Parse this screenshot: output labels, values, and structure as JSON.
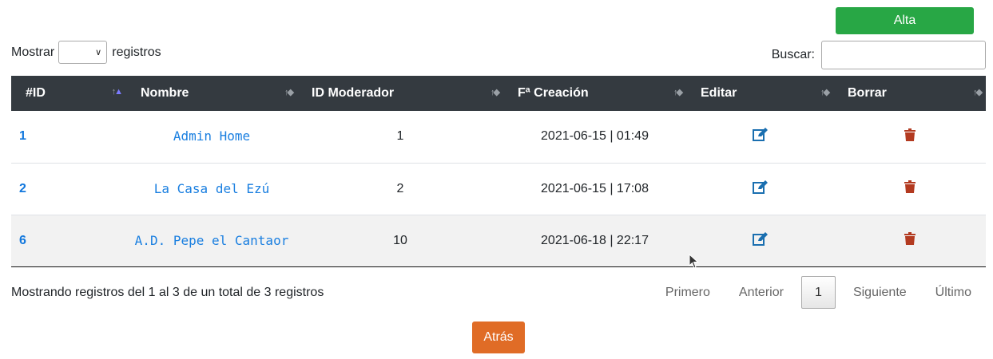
{
  "toolbar": {
    "add_label": "Alta"
  },
  "length": {
    "prefix": "Mostrar",
    "suffix": "registros",
    "value": ""
  },
  "search": {
    "label": "Buscar:",
    "value": ""
  },
  "table": {
    "columns": [
      "#ID",
      "Nombre",
      "ID Moderador",
      "Fª Creación",
      "Editar",
      "Borrar"
    ],
    "sorted_column": "#ID",
    "rows": [
      {
        "id": "1",
        "name": "Admin Home",
        "moderator_id": "1",
        "created": "2021-06-15 | 01:49"
      },
      {
        "id": "2",
        "name": "La Casa del Ezú",
        "moderator_id": "2",
        "created": "2021-06-15 | 17:08"
      },
      {
        "id": "6",
        "name": "A.D. Pepe el Cantaor",
        "moderator_id": "10",
        "created": "2021-06-18 | 22:17"
      }
    ],
    "edit_icon": "edit-icon",
    "delete_icon": "trash-icon"
  },
  "info": "Mostrando registros del 1 al 3 de un total de 3 registros",
  "pagination": {
    "first": "Primero",
    "previous": "Anterior",
    "current": "1",
    "next": "Siguiente",
    "last": "Último"
  },
  "back_label": "Atrás",
  "colors": {
    "add_button": "#28a745",
    "header_bg": "#343a40",
    "back_button": "#e06c26",
    "link": "#1a7fe0",
    "delete": "#b33a20",
    "edit": "#1a6fb0"
  }
}
